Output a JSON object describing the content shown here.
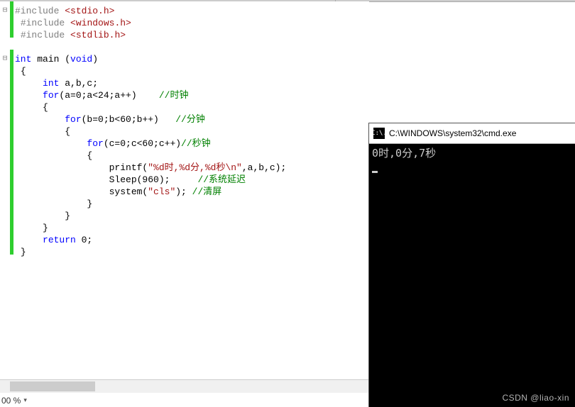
{
  "code": {
    "l1": {
      "pp": "#include",
      "inc": "<stdio.h>"
    },
    "l2": {
      "pp": "#include",
      "inc": "<windows.h>"
    },
    "l3": {
      "pp": "#include",
      "inc": "<stdlib.h>"
    },
    "l5a": "int",
    "l5b": " main (",
    "l5c": "void",
    "l5d": ")",
    "l6": "{",
    "l7a": "int",
    "l7b": " a,b,c;",
    "l8a": "for",
    "l8b": "(a=0;a<24;a++)    ",
    "l8c": "//时钟",
    "l9": "{",
    "l10a": "for",
    "l10b": "(b=0;b<60;b++)   ",
    "l10c": "//分钟",
    "l11": "{",
    "l12a": "for",
    "l12b": "(c=0;c<60;c++)",
    "l12c": "//秒钟",
    "l13": "{",
    "l14a": "printf(",
    "l14b": "\"%d时,%d分,%d秒\\n\"",
    "l14c": ",a,b,c);",
    "l15a": "Sleep(960);     ",
    "l15c": "//系统延迟",
    "l16a": "system(",
    "l16b": "\"cls\"",
    "l16c": "); ",
    "l16d": "//清屏",
    "l17": "}",
    "l18": "}",
    "l19": "}",
    "l20a": "return",
    "l20b": " 0;",
    "l21": "}"
  },
  "markers": {
    "m1": "⊟",
    "m5": "⊟"
  },
  "zoom": {
    "value": "00 %",
    "icon": "▾"
  },
  "console": {
    "icon": "C:\\.",
    "title": "C:\\WINDOWS\\system32\\cmd.exe",
    "output": "0时,0分,7秒"
  },
  "watermark": "CSDN @liao-xin"
}
